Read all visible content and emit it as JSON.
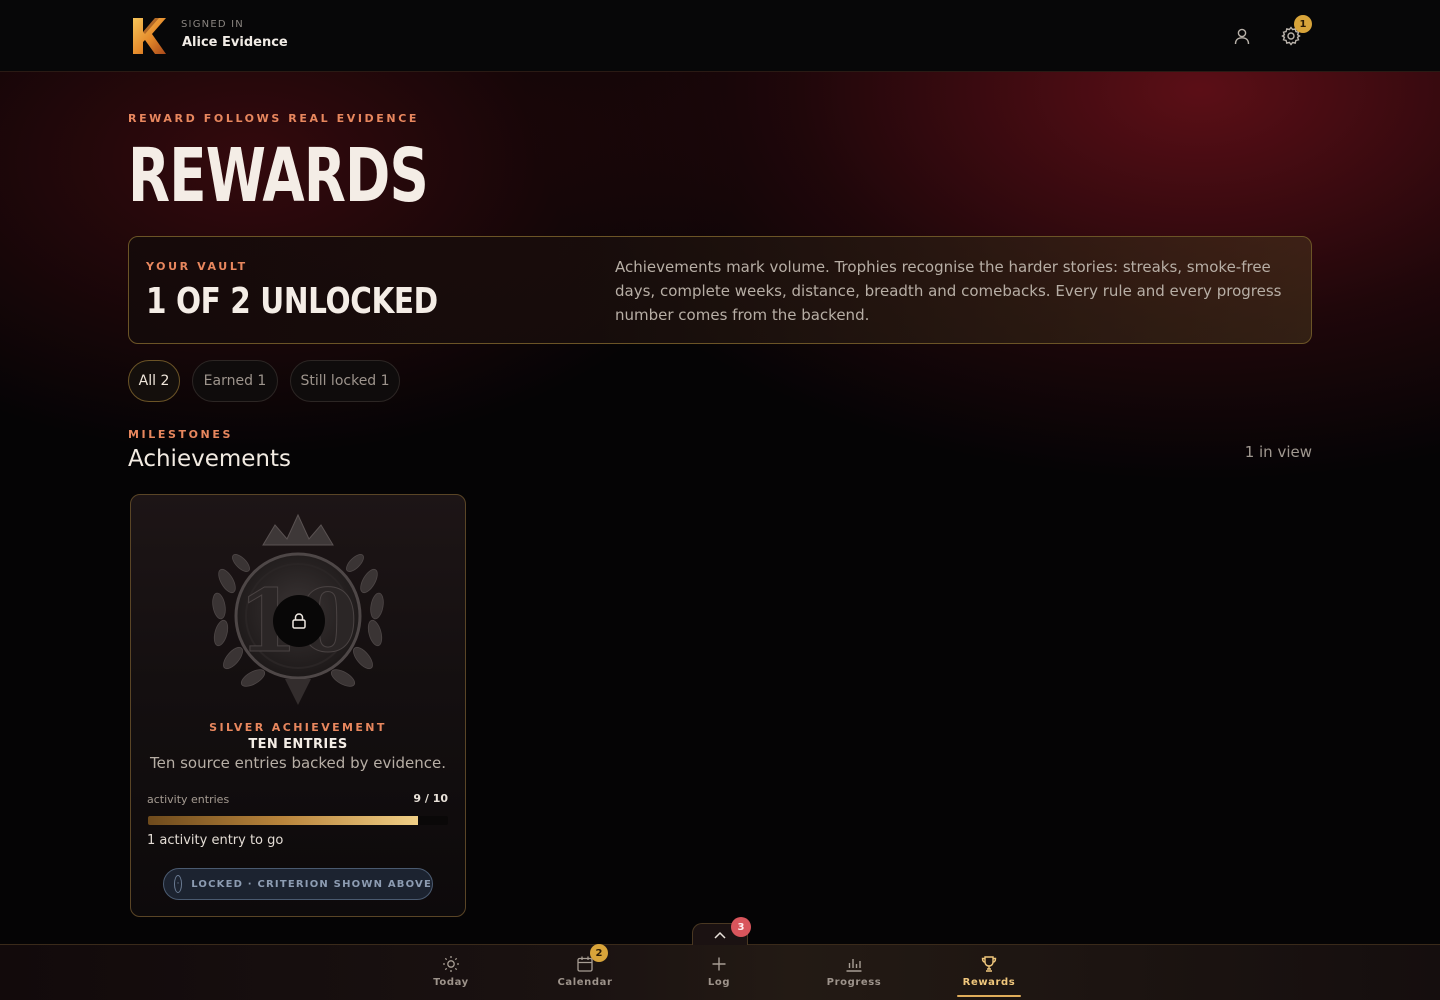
{
  "header": {
    "signed_in_label": "SIGNED IN",
    "user_name": "Alice Evidence",
    "settings_badge": "1"
  },
  "hero": {
    "eyebrow": "REWARD FOLLOWS REAL EVIDENCE",
    "title": "REWARDS"
  },
  "vault": {
    "eyebrow": "YOUR VAULT",
    "count_text": "1 OF 2 UNLOCKED",
    "description": "Achievements mark volume. Trophies recognise the harder stories: streaks, smoke-free days, complete weeks, distance, breadth and comebacks. Every rule and every progress number comes from the backend."
  },
  "filters": [
    {
      "label": "All 2",
      "active": true
    },
    {
      "label": "Earned 1",
      "active": false
    },
    {
      "label": "Still locked 1",
      "active": false
    }
  ],
  "section": {
    "eyebrow": "MILESTONES",
    "title": "Achievements",
    "in_view": "1 in view"
  },
  "achievements": [
    {
      "medal_number": "10",
      "tier": "SILVER ACHIEVEMENT",
      "name": "TEN ENTRIES",
      "description": "Ten source entries backed by evidence.",
      "metric_label": "activity entries",
      "metric_value": "9 / 10",
      "progress_fraction": 0.9,
      "to_go": "1 activity entry to go",
      "status": "LOCKED · CRITERION SHOWN ABOVE",
      "locked": true
    }
  ],
  "drawer": {
    "badge": "3"
  },
  "bottom_nav": [
    {
      "label": "Today",
      "icon": "sun-icon",
      "badge": null,
      "active": false
    },
    {
      "label": "Calendar",
      "icon": "calendar-icon",
      "badge": "2",
      "active": false
    },
    {
      "label": "Log",
      "icon": "plus-icon",
      "badge": null,
      "active": false
    },
    {
      "label": "Progress",
      "icon": "bar-chart-icon",
      "badge": null,
      "active": false
    },
    {
      "label": "Rewards",
      "icon": "trophy-icon",
      "badge": null,
      "active": true
    }
  ],
  "colors": {
    "accent_orange": "#e8875e",
    "accent_gold": "#d8a43a",
    "badge_red": "#d9555c",
    "vault_border": "#6b5426",
    "locked_status": "#8d9cb2"
  }
}
